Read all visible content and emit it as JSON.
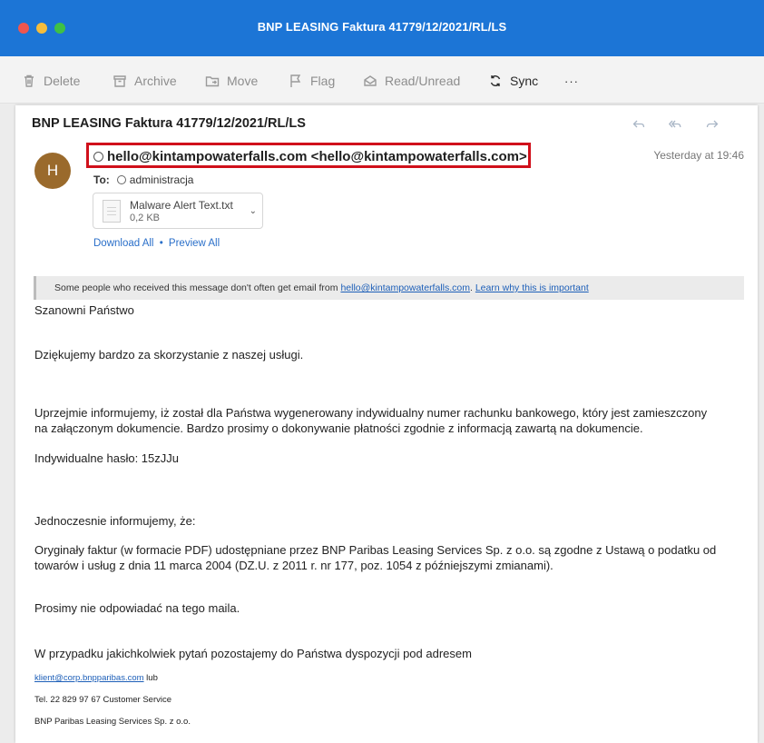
{
  "window": {
    "title": "BNP LEASING Faktura 41779/12/2021/RL/LS"
  },
  "toolbar": {
    "delete": "Delete",
    "archive": "Archive",
    "move": "Move",
    "flag": "Flag",
    "read_unread": "Read/Unread",
    "sync": "Sync",
    "more": "···"
  },
  "email": {
    "subject": "BNP LEASING Faktura 41779/12/2021/RL/LS",
    "avatar_initial": "H",
    "from": "hello@kintampowaterfalls.com <hello@kintampowaterfalls.com>",
    "timestamp": "Yesterday at 19:46",
    "to_label": "To:",
    "to": "administracja",
    "attachment": {
      "name": "Malware Alert Text.txt",
      "size": "0,2 KB"
    },
    "download_all": "Download All",
    "separator": "•",
    "preview_all": "Preview All",
    "notice": {
      "prefix": "Some people who received this message don't often get email from ",
      "sender_link": "hello@kintampowaterfalls.com",
      "dot": ". ",
      "learn_link": "Learn why this is important"
    },
    "body": {
      "greeting": "Szanowni Państwo",
      "line1": "Dziękujemy bardzo za skorzystanie z naszej usługi.",
      "line2a": "Uprzejmie informujemy, iż został dla Państwa wygenerowany indywidualny numer rachunku bankowego, który jest zamieszczony",
      "line2b": "na załączonym dokumencie. Bardzo prosimy o dokonywanie płatności zgodnie z informacją zawartą na dokumencie.",
      "password": "Indywidualne hasło: 15zJJu",
      "line3": "Jednoczesnie informujemy, że:",
      "line4a": "Oryginały faktur (w formacie PDF) udostępniane przez BNP Paribas Leasing Services Sp. z o.o. są zgodne z Ustawą o podatku od",
      "line4b": "towarów i usług z dnia 11 marca 2004 (DZ.U. z 2011 r. nr 177, poz. 1054 z późniejszymi zmianami).",
      "line5": "Prosimy nie odpowiadać na tego maila.",
      "line6": "W przypadku jakichkolwiek pytań pozostajemy do Państwa dyspozycji pod adresem",
      "contact_email": "klient@corp.bnpparibas.com",
      "contact_suffix": " lub",
      "phone": "Tel. 22 829 97 67 Customer Service",
      "company": "BNP Paribas Leasing Services  Sp. z o.o."
    }
  },
  "colors": {
    "titlebar": "#1c75d6",
    "highlight_box": "#d0101b",
    "avatar": "#9a6a2c",
    "link": "#2a6fc9"
  }
}
